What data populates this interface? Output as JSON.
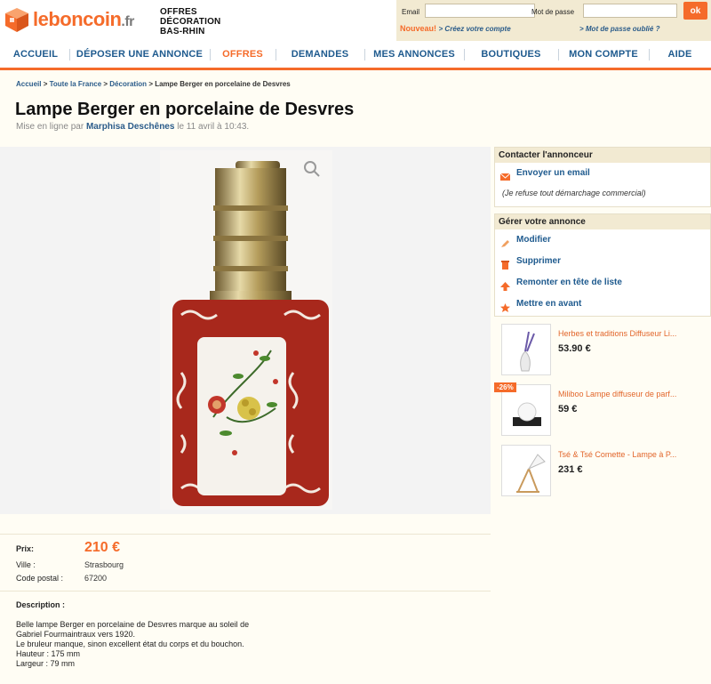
{
  "header": {
    "logo": {
      "name": "leboncoin",
      "tld": ".fr"
    },
    "section_lines": [
      "OFFRES",
      "DÉCORATION",
      "BAS-RHIN"
    ]
  },
  "login": {
    "email_label": "Email",
    "password_label": "Mot de passe",
    "email_value": "",
    "password_value": "",
    "ok_label": "ok",
    "nouveau_label": "Nouveau!",
    "create_link": "> Créez votre compte",
    "forgot_link": "> Mot de passe oublié ?"
  },
  "nav": {
    "items": [
      {
        "label": "ACCUEIL"
      },
      {
        "label": "DÉPOSER UNE ANNONCE"
      },
      {
        "label": "OFFRES",
        "active": true
      },
      {
        "label": "DEMANDES"
      },
      {
        "label": "MES ANNONCES"
      },
      {
        "label": "BOUTIQUES"
      },
      {
        "label": "MON COMPTE"
      },
      {
        "label": "AIDE"
      }
    ]
  },
  "breadcrumb": {
    "items": [
      "Accueil",
      "Toute la France",
      "Décoration"
    ],
    "separator": ">",
    "current": "Lampe Berger en porcelaine de Desvres"
  },
  "ad": {
    "title": "Lampe Berger en porcelaine de Desvres",
    "posted_prefix": "Mise en ligne par",
    "author": "Marphisa Deschênes",
    "posted_suffix": "le 11 avril à 10:43.",
    "price_label": "Prix:",
    "price": "210 €",
    "city_label": "Ville :",
    "city": "Strasbourg",
    "postal_label": "Code postal :",
    "postal": "67200",
    "description_label": "Description :",
    "description_lines": [
      "Belle lampe Berger en porcelaine de Desvres marque au soleil de",
      "Gabriel Fourmaintraux vers 1920.",
      "Le bruleur manque, sinon excellent état du corps et du bouchon.",
      "Hauteur : 175 mm",
      "Largeur : 79 mm"
    ]
  },
  "contact": {
    "heading": "Contacter l'annonceur",
    "email_link": "Envoyer un email",
    "refuse": "(Je refuse tout démarchage commercial)"
  },
  "manage": {
    "heading": "Gérer votre annonce",
    "items": [
      "Modifier",
      "Supprimer",
      "Remonter en tête de liste",
      "Mettre en avant"
    ]
  },
  "promos": [
    {
      "title": "Herbes et traditions Diffuseur Li...",
      "price": "53.90 €",
      "badge": ""
    },
    {
      "title": "Miliboo Lampe diffuseur de parf...",
      "price": "59 €",
      "badge": "-26%"
    },
    {
      "title": "Tsé & Tsé Comette - Lampe à P...",
      "price": "231 €",
      "badge": ""
    }
  ],
  "colors": {
    "brand_orange": "#f56b2a",
    "link_blue": "#1e5a8e",
    "page_bg": "#fffdf4",
    "panel_beige": "#f2ead2"
  }
}
